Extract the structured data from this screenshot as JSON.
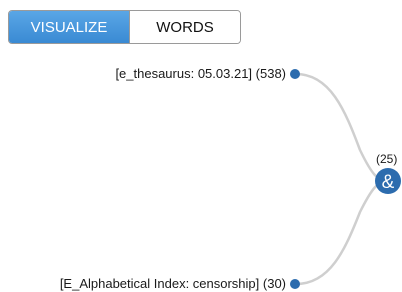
{
  "toggle": {
    "visualize_label": "VISUALIZE",
    "words_label": "WORDS",
    "active": "VISUALIZE"
  },
  "graph": {
    "nodes": [
      {
        "label": "[e_thesaurus: 05.03.21] (538)"
      },
      {
        "label": "[E_Alphabetical Index: censorship] (30)"
      }
    ],
    "join": {
      "count": "(25)",
      "symbol": "&"
    }
  },
  "colors": {
    "accent": "#3a8ad3",
    "node": "#2c6cae",
    "edge": "#cfcfcf"
  }
}
